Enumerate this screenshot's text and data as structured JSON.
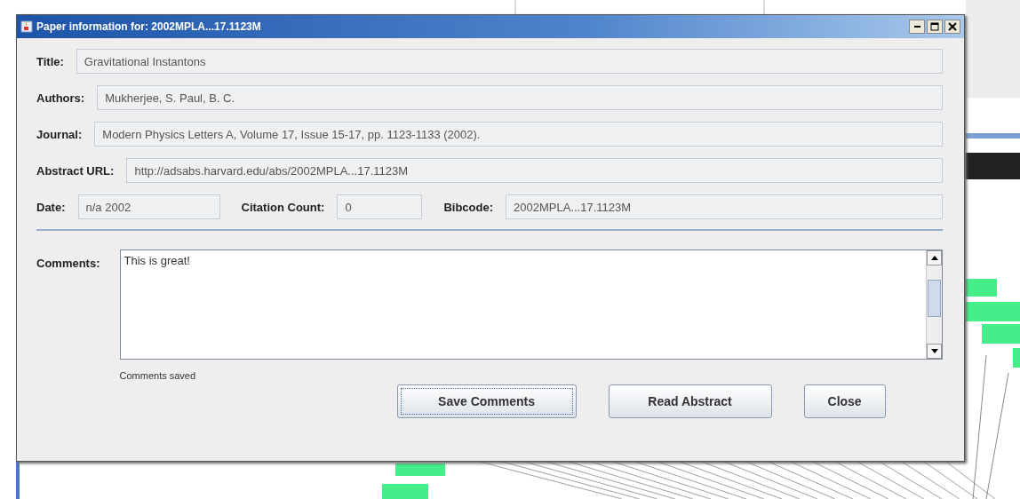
{
  "window": {
    "title": "Paper information for: 2002MPLA...17.1123M"
  },
  "fields": [
    {
      "label": "Title:",
      "value": "Gravitational Instantons"
    },
    {
      "label": "Authors:",
      "value": "Mukherjee, S. Paul, B. C."
    },
    {
      "label": "Journal:",
      "value": "Modern Physics Letters A, Volume 17, Issue 15-17, pp. 1123-1133 (2002)."
    },
    {
      "label": "Abstract URL:",
      "value": "http://adsabs.harvard.edu/abs/2002MPLA...17.1123M"
    }
  ],
  "info_row": [
    {
      "label": "Date:",
      "value": "n/a 2002"
    },
    {
      "label": "Citation Count:",
      "value": "0"
    },
    {
      "label": "Bibcode:",
      "value": "2002MPLA...17.1123M"
    }
  ],
  "comments": {
    "label": "Comments:",
    "value": "This is great!",
    "status": "Comments saved"
  },
  "buttons": [
    {
      "label": "Save Comments",
      "focused": true
    },
    {
      "label": "Read Abstract",
      "focused": false
    },
    {
      "label": "Close",
      "focused": false
    }
  ]
}
